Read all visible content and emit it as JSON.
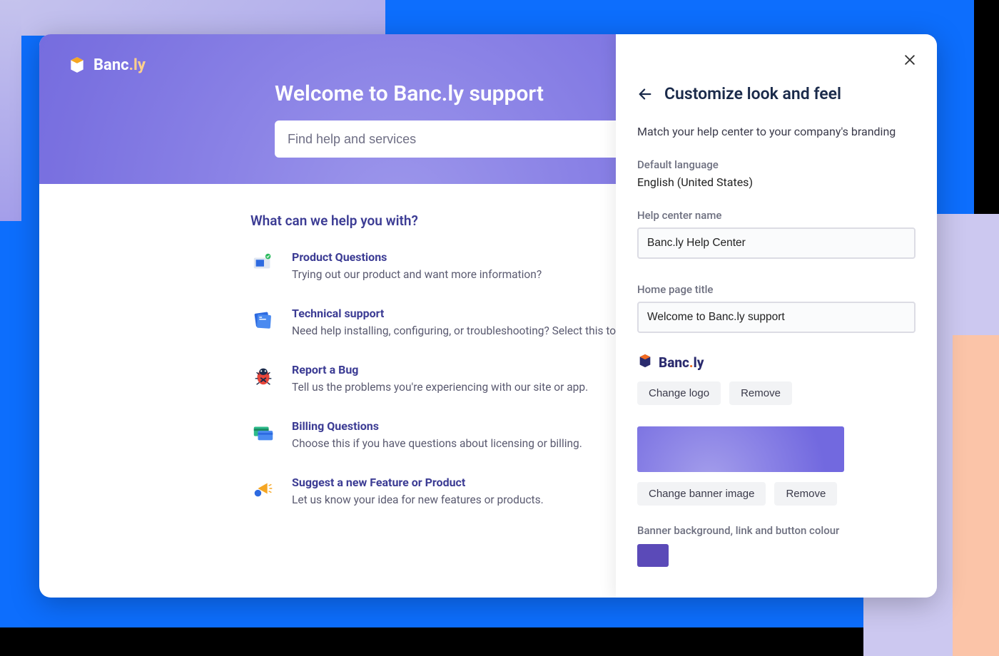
{
  "brand": {
    "name": "Banc",
    "suffix": ".ly"
  },
  "hero": {
    "title": "Welcome to Banc.ly support",
    "search_placeholder": "Find help and services"
  },
  "topics_heading": "What can we help you with?",
  "topics": [
    {
      "icon": "monitor-icon",
      "title": "Product Questions",
      "desc": "Trying out our product and want more information?"
    },
    {
      "icon": "folder-icon",
      "title": "Technical support",
      "desc": "Need help installing, configuring, or troubleshooting? Select this to"
    },
    {
      "icon": "bug-icon",
      "title": "Report a Bug",
      "desc": "Tell us the problems you're experiencing with our site or app."
    },
    {
      "icon": "credit-card-icon",
      "title": "Billing Questions",
      "desc": "Choose this if you have questions about licensing or billing."
    },
    {
      "icon": "megaphone-icon",
      "title": "Suggest a new Feature or Product",
      "desc": "Let us know your idea for new features or products."
    }
  ],
  "panel": {
    "title": "Customize look and feel",
    "subtitle": "Match your help center to your company's branding",
    "default_language_label": "Default language",
    "default_language_value": "English (United States)",
    "help_center_name_label": "Help center name",
    "help_center_name_value": "Banc.ly Help Center",
    "home_page_title_label": "Home page title",
    "home_page_title_value": "Welcome to Banc.ly support",
    "logo_brand": "Banc",
    "logo_suffix_dot": ".",
    "logo_suffix_ly": "ly",
    "change_logo": "Change logo",
    "remove_logo": "Remove",
    "change_banner": "Change banner image",
    "remove_banner": "Remove",
    "color_label": "Banner background, link and button colour",
    "color_value": "#5b4ab8"
  }
}
